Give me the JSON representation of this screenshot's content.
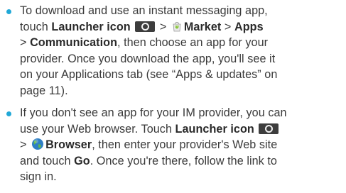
{
  "items": [
    {
      "lines": [
        {
          "t1": "To download and use an instant messaging app,"
        },
        {
          "t1": "touch ",
          "b1": "Launcher icon",
          "t2": " > ",
          "b2": "Market",
          "t3": " > ",
          "b3": "Apps"
        },
        {
          "t1": "> ",
          "b1": "Communication",
          "t2": ", then choose an app for your"
        },
        {
          "t1": "provider. Once you download the app, you'll see it"
        },
        {
          "t1": "on your Applications tab (see “Apps & updates” on"
        },
        {
          "t1": "page 11)."
        }
      ]
    },
    {
      "lines": [
        {
          "t1": "If you don't see an app for your IM provider, you can"
        },
        {
          "t1": "use your Web browser. Touch ",
          "b1": "Launcher icon"
        },
        {
          "t1": "> ",
          "b1": "Browser",
          "t2": ", then enter your provider's Web site"
        },
        {
          "t1": "and touch ",
          "b1": "Go",
          "t2": ". Once you're there, follow the link to"
        },
        {
          "t1": "sign in."
        }
      ]
    }
  ],
  "icons": {
    "bullet_color": "#21a8d7",
    "launcher": "launcher-icon",
    "market": "market-icon",
    "browser": "browser-icon"
  }
}
